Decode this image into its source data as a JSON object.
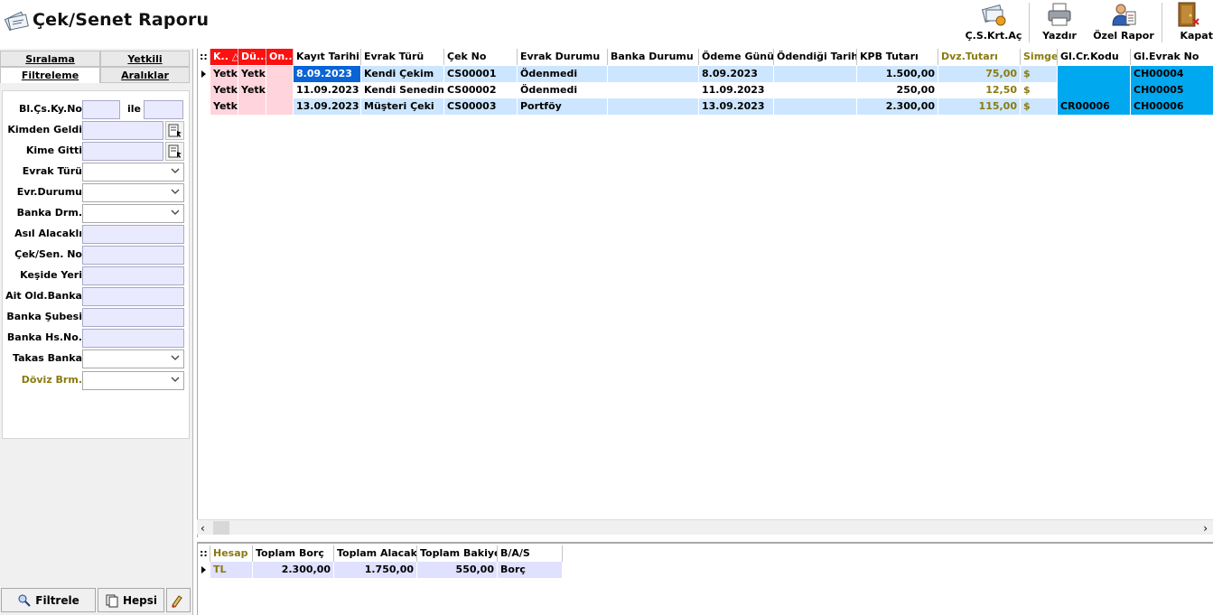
{
  "app": {
    "title": "Çek/Senet Raporu",
    "title_icon": "checks-report-icon"
  },
  "toolbar": {
    "buttons": [
      {
        "label": "Ç.S.Krt.Aç",
        "icon": "card-open-icon"
      },
      {
        "label": "Yazdır",
        "icon": "printer-icon"
      },
      {
        "label": "Özel Rapor",
        "icon": "user-report-icon"
      },
      {
        "label": "Kapat",
        "icon": "door-close-icon"
      }
    ]
  },
  "tabs": {
    "siralama": "Sıralama",
    "yetkili": "Yetkili",
    "filtreleme": "Filtreleme",
    "araliklar": "Aralıklar"
  },
  "filters": {
    "bl_cs_ky_no": {
      "label": "Bl.Çs.Ky.No",
      "between": "ile",
      "from": "",
      "to": ""
    },
    "kimden_geldi": {
      "label": "Kimden Geldi",
      "value": ""
    },
    "kime_gitti": {
      "label": "Kime Gitti",
      "value": ""
    },
    "evrak_turu": {
      "label": "Evrak Türü",
      "value": ""
    },
    "evr_durumu": {
      "label": "Evr.Durumu",
      "value": ""
    },
    "banka_drm": {
      "label": "Banka Drm.",
      "value": ""
    },
    "asil_alacakli": {
      "label": "Asıl Alacaklı",
      "value": ""
    },
    "cek_sen_no": {
      "label": "Çek/Sen. No",
      "value": ""
    },
    "keside_yeri": {
      "label": "Keşide Yeri",
      "value": ""
    },
    "ait_old_banka": {
      "label": "Ait Old.Banka",
      "value": ""
    },
    "banka_subesi": {
      "label": "Banka Şubesi",
      "value": ""
    },
    "banka_hs_no": {
      "label": "Banka Hs.No.",
      "value": ""
    },
    "takas_banka": {
      "label": "Takas Banka",
      "value": ""
    },
    "doviz_brm": {
      "label": "Döviz Brm.",
      "value": ""
    }
  },
  "left_buttons": {
    "filtrele": "Filtrele",
    "hepsi": "Hepsi"
  },
  "grid": {
    "corner": "::",
    "columns": [
      "K..",
      "Dü...",
      "On...",
      "Kayıt Tarihi",
      "Evrak Türü",
      "Çek No",
      "Evrak Durumu",
      "Banka Durumu",
      "Ödeme Günü",
      "Ödendiği Tarih",
      "KPB Tutarı",
      "Dvz.Tutarı",
      "Simge",
      "Gl.Cr.Kodu",
      "Gl.Evrak No"
    ],
    "sort_indicator": "△",
    "rows": [
      [
        "Yetk",
        "Yetk",
        "",
        "8.09.2023",
        "Kendi Çekim",
        "CS00001",
        "Ödenmedi",
        "",
        "8.09.2023",
        "",
        "1.500,00",
        "75,00",
        "$",
        "",
        "CH00004"
      ],
      [
        "Yetk",
        "Yetk",
        "",
        "11.09.2023",
        "Kendi Senedim",
        "CS00002",
        "Ödenmedi",
        "",
        "11.09.2023",
        "",
        "250,00",
        "12,50",
        "$",
        "",
        "CH00005"
      ],
      [
        "Yetk",
        "",
        "",
        "13.09.2023",
        "Müşteri Çeki",
        "CS00003",
        "Portföy",
        "",
        "13.09.2023",
        "",
        "2.300,00",
        "115,00",
        "$",
        "CR00006",
        "CH00006"
      ]
    ]
  },
  "summary": {
    "corner": "::",
    "columns": [
      "Hesap",
      "Toplam Borç",
      "Toplam Alacak",
      "Toplam Bakiye",
      "B/A/S"
    ],
    "rows": [
      [
        "TL",
        "2.300,00",
        "1.750,00",
        "550,00",
        "Borç"
      ]
    ]
  },
  "colors": {
    "pink": "#ffd4dc",
    "light_blue": "#cde6ff",
    "selected": "#0a64d6",
    "cyan": "#00a8f0",
    "gold": "#8a7a10",
    "red": "#ff1010"
  }
}
